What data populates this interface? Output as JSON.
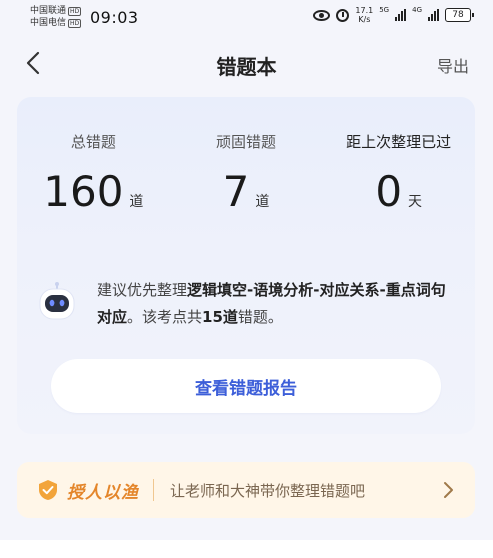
{
  "status_bar": {
    "carrier1": "中国联通",
    "carrier2": "中国电信",
    "hd_badge": "HD",
    "time": "09:03",
    "net_speed": "17.1",
    "net_speed_unit": "K/s",
    "net_type1": "5G",
    "net_type2": "4G",
    "battery": "78"
  },
  "nav": {
    "title": "错题本",
    "export_label": "导出"
  },
  "stats": [
    {
      "label": "总错题",
      "value": "160",
      "unit": "道"
    },
    {
      "label": "顽固错题",
      "value": "7",
      "unit": "道"
    },
    {
      "label": "距上次整理已过",
      "value": "0",
      "unit": "天"
    }
  ],
  "advice": {
    "prefix": "建议优先整理",
    "topic": "逻辑填空-语境分析-对应关系-重点词句对应",
    "middle": "。该考点共",
    "count": "15道",
    "suffix": "错题。"
  },
  "report_button": "查看错题报告",
  "promo": {
    "brand": "授人以渔",
    "text": "让老师和大神带你整理错题吧"
  },
  "colors": {
    "accent_blue": "#3d5fd9",
    "promo_orange": "#e4862b",
    "promo_bg": "#fff6e8"
  }
}
